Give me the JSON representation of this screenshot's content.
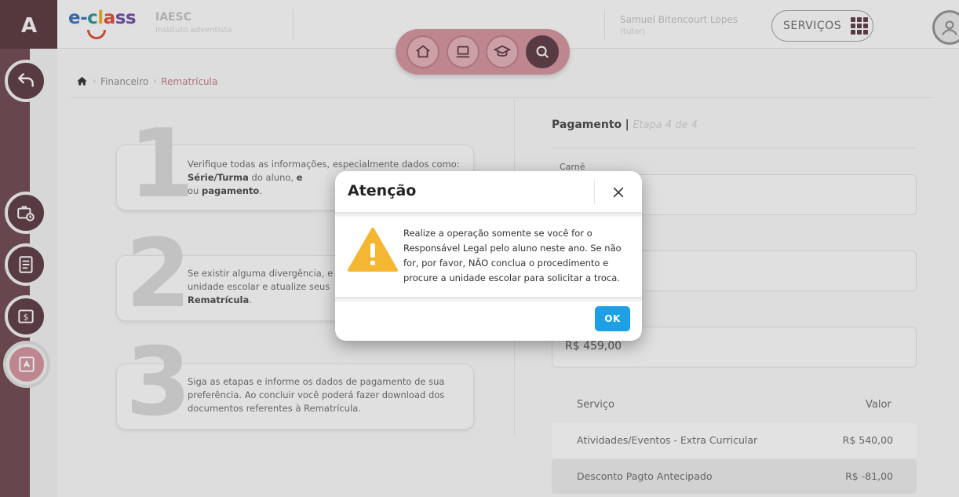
{
  "app": {
    "brand": "e-class",
    "institution_name": "IAESC",
    "institution_sub": "Instituto adventista",
    "user_name": "Samuel Bitencourt Lopes",
    "user_role": "(tutor)",
    "services_label": "SERVIÇOS"
  },
  "nav": {
    "icons": [
      "home-icon",
      "laptop-icon",
      "school-icon",
      "search-icon"
    ]
  },
  "breadcrumb": {
    "items": [
      "Financeiro",
      "Rematrícula"
    ]
  },
  "steps": [
    {
      "number": "1",
      "text_html_parts": [
        "Verifique todas as informações, especialmente dados como: ",
        "Série/Turma",
        " do aluno, ",
        "e",
        "",
        "ou ",
        "pagamento",
        "."
      ]
    },
    {
      "number": "2"
    },
    {
      "number": "3"
    }
  ],
  "step_texts": {
    "s1_a": "Verifique todas as informações, especialmente dados como: ",
    "s1_b": "Série/Turma",
    "s1_c": " do aluno, ",
    "s1_d": "e",
    "s1_e": "ou ",
    "s1_f": "pagamento",
    "s1_g": ".",
    "s2_a": "Se existir alguma divergência, e",
    "s2_b": "unidade escolar e atualize seus",
    "s2_c": "Rematrícula",
    "s2_d": ".",
    "s3": "Siga as etapas e informe os dados de pagamento de sua preferência. Ao concluir você poderá fazer download dos documentos referentes à Rematrícula."
  },
  "payment": {
    "title": "Pagamento",
    "separator": "|",
    "step": "Etapa 4 de 4",
    "fields": [
      {
        "label": "Carnê",
        "value": ""
      },
      {
        "label": "",
        "value": ""
      },
      {
        "label": "",
        "value": "R$ 459,00"
      }
    ],
    "table": {
      "headers": [
        "Serviço",
        "Valor"
      ],
      "rows": [
        {
          "service": "Atividades/Eventos - Extra Curricular",
          "value": "R$ 540,00"
        },
        {
          "service": "Desconto Pagto Antecipado",
          "value": "R$ -81,00"
        }
      ]
    }
  },
  "modal": {
    "title": "Atenção",
    "message": "Realize a operação somente se você for o Responsável Legal pelo aluno neste ano. Se não for, por favor, NÃO conclua o procedimento e procure a unidade escolar para solicitar a troca.",
    "ok_label": "OK",
    "warning_color": "#f5b632",
    "ok_color": "#1ea0e6"
  }
}
